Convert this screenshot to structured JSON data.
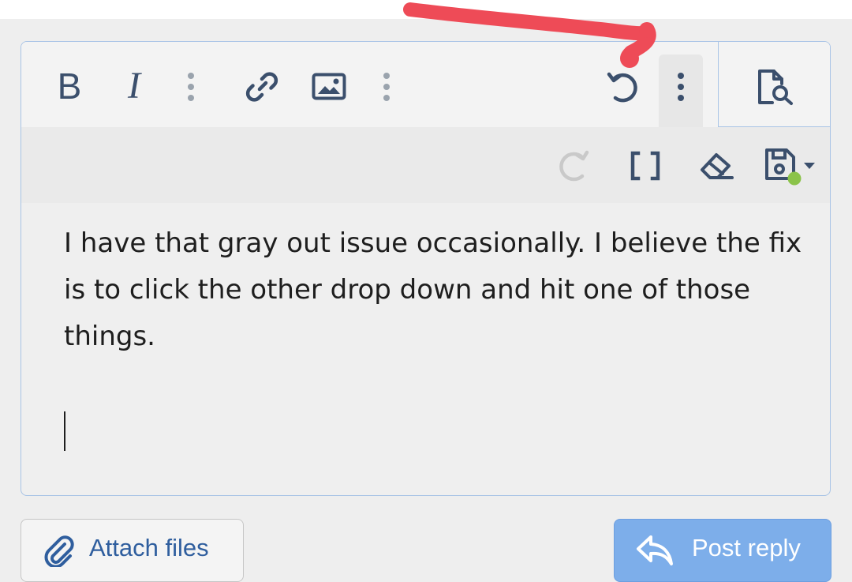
{
  "toolbar": {
    "bold_label": "B",
    "italic_label": "I",
    "icons": [
      "bold-icon",
      "italic-icon",
      "more-dots-icon",
      "link-icon",
      "image-icon",
      "more-dots-icon",
      "undo-icon",
      "more-dots-icon",
      "preview-icon",
      "redo-icon",
      "brackets-icon",
      "eraser-icon",
      "save-draft-icon",
      "dropdown-caret-icon"
    ],
    "draft_indicator_color": "#8bc34a",
    "disabled_color": "#c9c9c9"
  },
  "editor": {
    "content": "I have that gray out issue occasionally. I believe the fix is to click the other drop down and hit one of those things."
  },
  "actions": {
    "attach_label": "Attach files",
    "post_label": "Post reply"
  },
  "colors": {
    "accent": "#2f5e9e",
    "primary_button": "#7daeea",
    "annotation_stroke": "#ee4b57",
    "border": "#a9c4e6"
  }
}
